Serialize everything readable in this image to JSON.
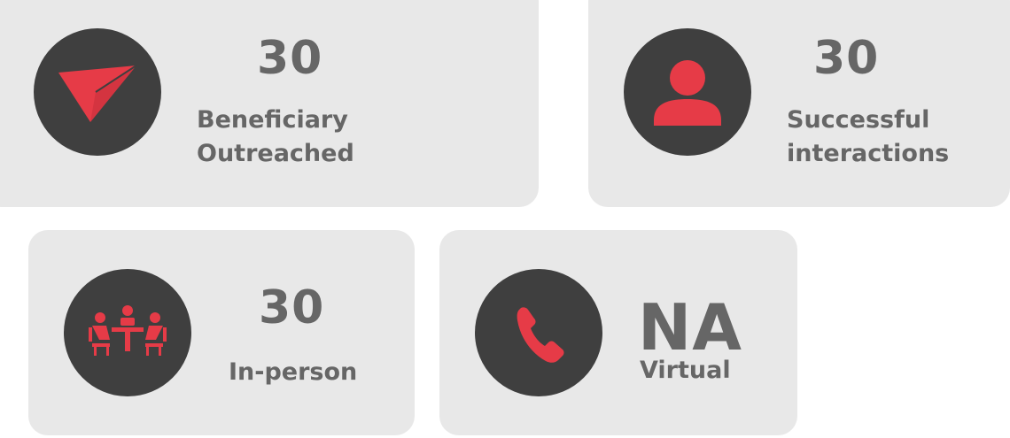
{
  "accent_color": "#e63b47",
  "cards": [
    {
      "icon": "paper-plane-icon",
      "value": "30",
      "label_line1": "Beneficiary",
      "label_line2": "Outreached"
    },
    {
      "icon": "user-icon",
      "value": "30",
      "label_line1": "Successful",
      "label_line2": "interactions"
    },
    {
      "icon": "meeting-table-icon",
      "value": "30",
      "label_line1": "In-person"
    },
    {
      "icon": "phone-icon",
      "value": "NA",
      "label_line1": "Virtual"
    }
  ]
}
